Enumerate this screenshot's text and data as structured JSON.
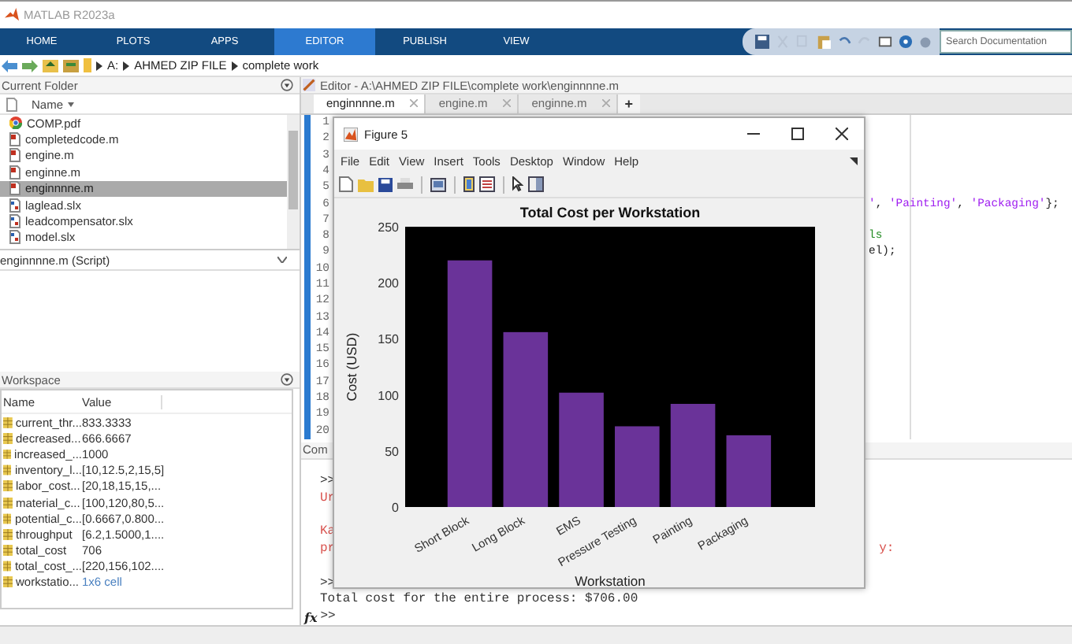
{
  "app_title": "MATLAB R2023a",
  "ribbon_tabs": [
    {
      "label": "HOME",
      "selected": false
    },
    {
      "label": "PLOTS",
      "selected": false
    },
    {
      "label": "APPS",
      "selected": false
    },
    {
      "label": "EDITOR",
      "selected": true
    },
    {
      "label": "PUBLISH",
      "selected": false
    },
    {
      "label": "VIEW",
      "selected": false
    }
  ],
  "search": {
    "placeholder": "Search Documentation"
  },
  "address": [
    "A:",
    "AHMED ZIP FILE",
    "complete work"
  ],
  "current_folder": {
    "title": "Current Folder",
    "column": "Name",
    "files": [
      {
        "name": "COMP.pdf",
        "kind": "pdf",
        "selected": false
      },
      {
        "name": "completedcode.m",
        "kind": "m",
        "selected": false
      },
      {
        "name": "engine.m",
        "kind": "m",
        "selected": false
      },
      {
        "name": "enginne.m",
        "kind": "m",
        "selected": false
      },
      {
        "name": "enginnnne.m",
        "kind": "m",
        "selected": true
      },
      {
        "name": "laglead.slx",
        "kind": "slx",
        "selected": false
      },
      {
        "name": "leadcompensator.slx",
        "kind": "slx",
        "selected": false
      },
      {
        "name": "model.slx",
        "kind": "slx",
        "selected": false
      }
    ],
    "details": "enginnnne.m  (Script)"
  },
  "workspace": {
    "title": "Workspace",
    "columns": [
      "Name",
      "Value"
    ],
    "rows": [
      {
        "name": "current_thr...",
        "value": "833.3333",
        "kind": "number"
      },
      {
        "name": "decreased...",
        "value": "666.6667",
        "kind": "number"
      },
      {
        "name": "increased_...",
        "value": "1000",
        "kind": "number"
      },
      {
        "name": "inventory_l...",
        "value": "[10,12.5,2,15,5]",
        "kind": "number"
      },
      {
        "name": "labor_cost...",
        "value": "[20,18,15,15,...",
        "kind": "number"
      },
      {
        "name": "material_c...",
        "value": "[100,120,80,5...",
        "kind": "number"
      },
      {
        "name": "potential_c...",
        "value": "[0.6667,0.800...",
        "kind": "number"
      },
      {
        "name": "throughput",
        "value": "[6.2,1.5000,1....",
        "kind": "number"
      },
      {
        "name": "total_cost",
        "value": "706",
        "kind": "number"
      },
      {
        "name": "total_cost_...",
        "value": "[220,156,102....",
        "kind": "number"
      },
      {
        "name": "workstatio...",
        "value": "1x6 cell",
        "kind": "cell"
      }
    ]
  },
  "editor": {
    "title": "Editor - A:\\AHMED ZIP FILE\\complete work\\enginnnne.m",
    "tabs": [
      {
        "label": "enginnnne.m",
        "selected": true
      },
      {
        "label": "engine.m",
        "selected": false
      },
      {
        "label": "enginne.m",
        "selected": false
      }
    ],
    "new_tab": "+",
    "lines": [
      {
        "number": "1"
      },
      {
        "number": "2"
      },
      {
        "number": "3"
      },
      {
        "number": "4"
      },
      {
        "number": "5"
      },
      {
        "number": "6",
        "tokens": [
          {
            "text": "'",
            "kind": "string"
          },
          {
            "text": ", ",
            "kind": "plain"
          },
          {
            "text": "'Painting'",
            "kind": "string"
          },
          {
            "text": ", ",
            "kind": "plain"
          },
          {
            "text": "'Packaging'",
            "kind": "string"
          },
          {
            "text": "};",
            "kind": "plain"
          }
        ]
      },
      {
        "number": "7"
      },
      {
        "number": "8",
        "tokens": [
          {
            "text": "ls",
            "kind": "comment"
          }
        ]
      },
      {
        "number": "9",
        "tokens": [
          {
            "text": "el);",
            "kind": "plain"
          }
        ]
      },
      {
        "number": "10"
      },
      {
        "number": "11"
      },
      {
        "number": "12"
      },
      {
        "number": "13"
      },
      {
        "number": "14"
      },
      {
        "number": "15"
      },
      {
        "number": "16"
      },
      {
        "number": "17"
      },
      {
        "number": "18"
      },
      {
        "number": "19"
      },
      {
        "number": "20"
      }
    ]
  },
  "command_window": {
    "title": "Com",
    "lines": [
      {
        "text": ">>",
        "kind": "plain",
        "blank_before": true
      },
      {
        "text": "Ur",
        "kind": "error",
        "blank_before": false
      },
      {
        "text": "Ka",
        "kind": "error",
        "blank_before": true
      },
      {
        "text": "pr",
        "right": "y:",
        "kind": "error",
        "blank_before": false
      },
      {
        "text": ">>",
        "kind": "plain",
        "blank_before": true
      },
      {
        "text": "Total cost for the entire process: $706.00",
        "kind": "plain",
        "blank_before": false
      }
    ],
    "prompt_icon": "fx",
    "prompt": ">>"
  },
  "figure": {
    "title": "Figure 5",
    "menu": [
      "File",
      "Edit",
      "View",
      "Insert",
      "Tools",
      "Desktop",
      "Window",
      "Help"
    ],
    "chart_data": {
      "type": "bar",
      "title": "Total Cost per Workstation",
      "xlabel": "Workstation",
      "ylabel": "Cost (USD)",
      "categories": [
        "Short Block",
        "Long Block",
        "EMS",
        "Pressure Testing",
        "Painting",
        "Packaging"
      ],
      "series": [
        {
          "color": "#6a3399",
          "values": [
            220,
            156,
            102,
            72,
            92,
            64
          ]
        }
      ],
      "ylim": [
        0,
        250
      ],
      "yticks": [
        0,
        50,
        100,
        150,
        200,
        250
      ]
    }
  }
}
